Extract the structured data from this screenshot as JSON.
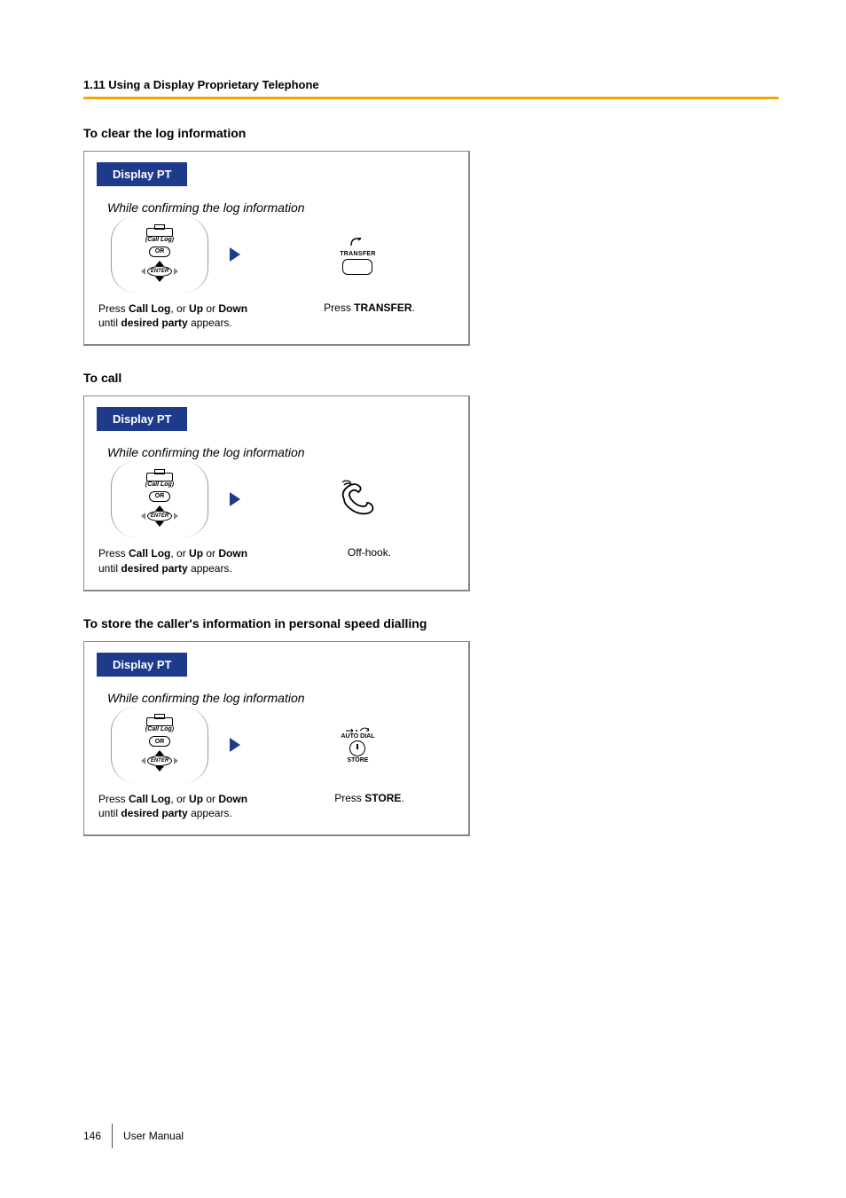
{
  "header": {
    "section_number": "1.11",
    "section_title": "Using a Display Proprietary Telephone"
  },
  "sections": [
    {
      "heading": "To clear the log information",
      "pill": "Display PT",
      "context": "While confirming the log information",
      "step1": {
        "call_log_label": "(Call Log)",
        "or_label": "OR",
        "enter_label": "ENTER",
        "caption_prefix": "Press ",
        "caption_bold1": "Call Log",
        "caption_mid": ", or ",
        "caption_bold2": "Up",
        "caption_or": " or ",
        "caption_bold3": "Down",
        "caption_line2a": "until ",
        "caption_line2b": "desired party",
        "caption_line2c": " appears."
      },
      "step2": {
        "icon_label": "TRANSFER",
        "caption_prefix": "Press ",
        "caption_bold": "TRANSFER",
        "caption_suffix": "."
      }
    },
    {
      "heading": "To call",
      "pill": "Display PT",
      "context": "While confirming the log information",
      "step1": {
        "call_log_label": "(Call Log)",
        "or_label": "OR",
        "enter_label": "ENTER",
        "caption_prefix": "Press ",
        "caption_bold1": "Call Log",
        "caption_mid": ", or ",
        "caption_bold2": "Up",
        "caption_or": " or ",
        "caption_bold3": "Down",
        "caption_line2a": "until ",
        "caption_line2b": "desired party",
        "caption_line2c": " appears."
      },
      "step2": {
        "caption": "Off-hook."
      }
    },
    {
      "heading": "To store the caller's information in personal speed dialling",
      "pill": "Display PT",
      "context": "While confirming the log information",
      "step1": {
        "call_log_label": "(Call Log)",
        "or_label": "OR",
        "enter_label": "ENTER",
        "caption_prefix": "Press ",
        "caption_bold1": "Call Log",
        "caption_mid": ", or ",
        "caption_bold2": "Up",
        "caption_or": " or ",
        "caption_bold3": "Down",
        "caption_line2a": "until ",
        "caption_line2b": "desired party",
        "caption_line2c": " appears."
      },
      "step2": {
        "icon_label_top": "AUTO DIAL",
        "icon_label_bottom": "STORE",
        "caption_prefix": "Press ",
        "caption_bold": "STORE",
        "caption_suffix": "."
      }
    }
  ],
  "footer": {
    "page_number": "146",
    "doc_title": "User Manual"
  }
}
